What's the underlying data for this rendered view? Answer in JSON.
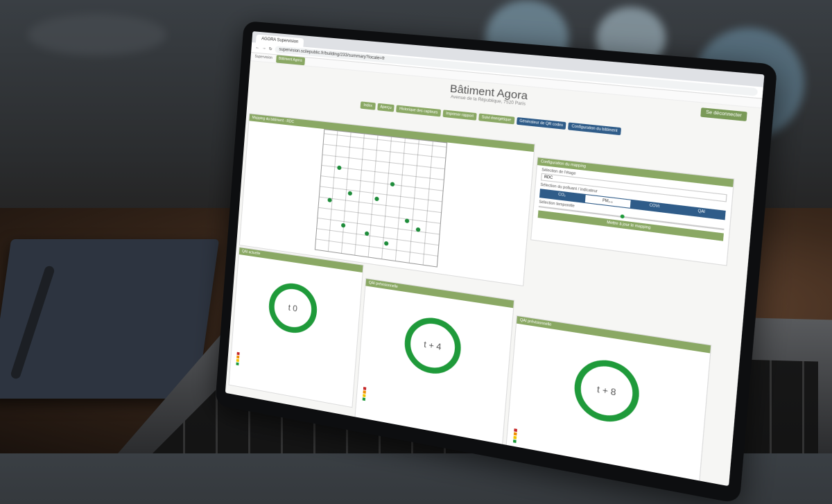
{
  "browser": {
    "tab_title": "AGORA Supervision",
    "url": "supervision.scilepublic.fr/building/233/summary?locale=fr"
  },
  "breadcrumb": {
    "root": "Supervision",
    "items": [
      "Bâtiment Agora"
    ]
  },
  "header": {
    "title": "Bâtiment Agora",
    "subtitle": "Avenue de la République, 7520 Paris",
    "logout_label": "Se déconnecter"
  },
  "nav": {
    "buttons": [
      "Index",
      "Aperçu",
      "Historique des capteurs",
      "Imprimer rapport",
      "Suivi énergétique",
      "Générateur de QR codes",
      "Configuration du bâtiment"
    ]
  },
  "mapping": {
    "header": "Mapping du bâtiment - RDC"
  },
  "config": {
    "header": "Configuration du mapping",
    "floor_label": "Sélection de l'étage",
    "floor_value": "RDC",
    "indicator_label": "Sélection du polluant / indicateur",
    "pollutants": [
      "CO₂",
      "PM₂.₅",
      "COVt",
      "QAI"
    ],
    "period_label": "Sélection temporelle",
    "apply_label": "Mettre à jour le mapping"
  },
  "gauges": [
    {
      "header": "QAI actuelle",
      "label": "t 0"
    },
    {
      "header": "QAI prévisionnelle",
      "label": "t + 4"
    },
    {
      "header": "QAI prévisionnelle",
      "label": "t + 8"
    }
  ],
  "colors": {
    "accent_green": "#8aa864",
    "ring_green": "#1f9a3a",
    "nav_blue": "#2f5c89"
  }
}
